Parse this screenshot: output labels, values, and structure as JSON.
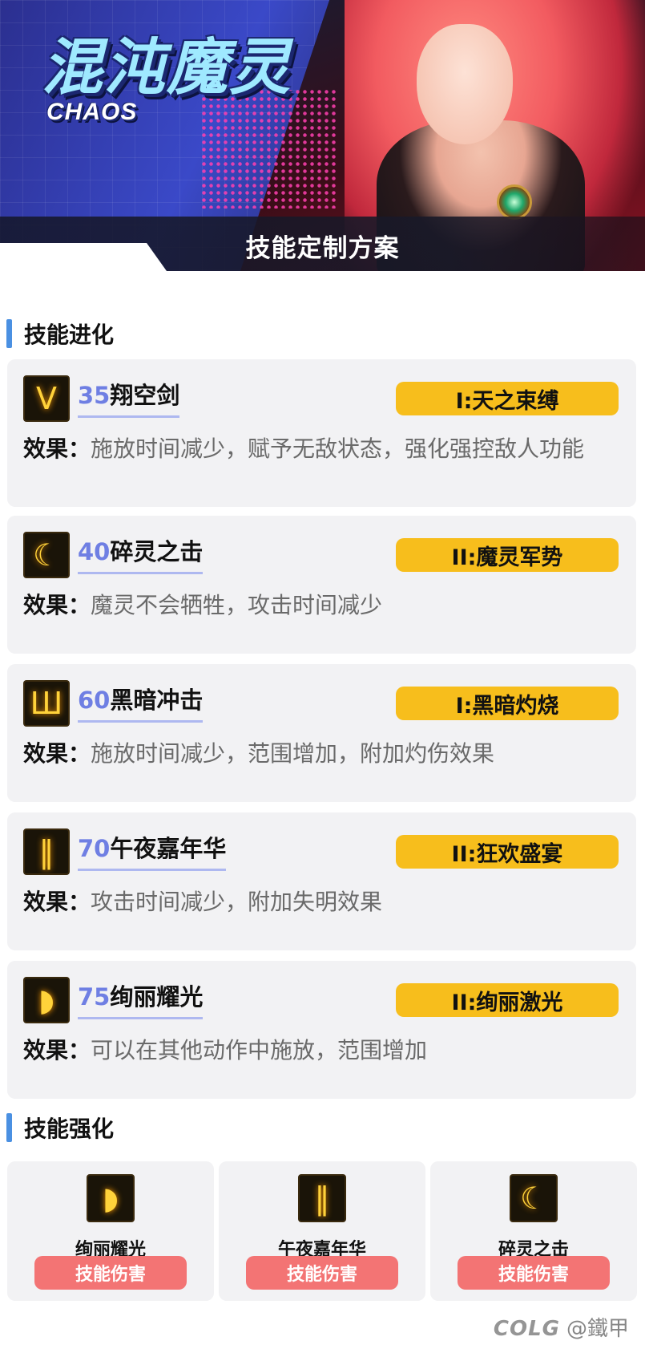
{
  "banner": {
    "title": "混沌魔灵",
    "subtitle": "CHAOS",
    "bar_title": "技能定制方案"
  },
  "sections": {
    "evolution": "技能进化",
    "enhance": "技能强化"
  },
  "effect_label": "效果：",
  "skills": [
    {
      "level": "35",
      "name": "翔空剑",
      "evolution": "I:天之束缚",
      "effect": "施放时间减少，赋予无敌状态，强化强控敌人功能",
      "icon": "wings-slash-icon"
    },
    {
      "level": "40",
      "name": "碎灵之击",
      "evolution": "II:魔灵军势",
      "effect": "魔灵不会牺牲，攻击时间减少",
      "icon": "spirit-strike-icon"
    },
    {
      "level": "60",
      "name": "黑暗冲击",
      "evolution": "I:黑暗灼烧",
      "effect": "施放时间减少，范围增加，附加灼伤效果",
      "icon": "dark-impact-icon"
    },
    {
      "level": "70",
      "name": "午夜嘉年华",
      "evolution": "II:狂欢盛宴",
      "effect": "攻击时间减少，附加失明效果",
      "icon": "midnight-carnival-icon"
    },
    {
      "level": "75",
      "name": "绚丽耀光",
      "evolution": "II:绚丽激光",
      "effect": "可以在其他动作中施放，范围增加",
      "icon": "brilliant-light-icon"
    }
  ],
  "enhance": [
    {
      "name": "绚丽耀光",
      "button": "技能伤害",
      "icon": "brilliant-light-icon"
    },
    {
      "name": "午夜嘉年华",
      "button": "技能伤害",
      "icon": "midnight-carnival-icon"
    },
    {
      "name": "碎灵之击",
      "button": "技能伤害",
      "icon": "spirit-strike-icon"
    }
  ],
  "watermark": {
    "logo": "COLG",
    "author": "@鐵甲"
  },
  "colors": {
    "accent_blue": "#4a90e2",
    "level_blue": "#6f7fe3",
    "badge_yellow": "#f7be1c",
    "button_red": "#f37474",
    "card_bg": "#f2f2f4"
  }
}
